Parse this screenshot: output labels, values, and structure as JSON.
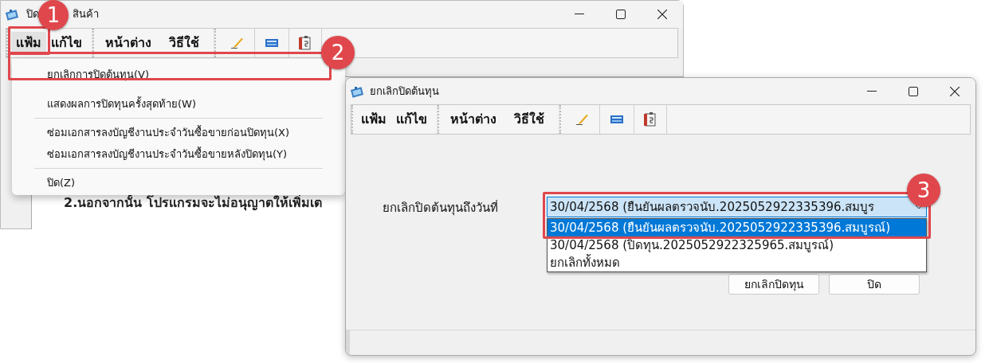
{
  "back_window": {
    "title_parts": [
      "ปิด",
      "สินค้า"
    ],
    "menu": [
      {
        "label": "แฟ้ม",
        "selected": true
      },
      {
        "label": "แก้ไข",
        "selected": false
      },
      {
        "label": "หน้าต่าง",
        "selected": false
      },
      {
        "label": "วิธีใช้",
        "selected": false
      }
    ],
    "dropdown_menu": [
      {
        "kind": "item",
        "label": "ยกเลิกการปิดต้นทุน(V)"
      },
      {
        "kind": "item",
        "label": "แสดงผลการปิดทุนครั้งสุดท้าย(W)"
      },
      {
        "kind": "separator"
      },
      {
        "kind": "item",
        "label": "ซ่อมเอกสารลงบัญชีงานประจำวันซื้อขายก่อนปิดทุน(X)"
      },
      {
        "kind": "item",
        "label": "ซ่อมเอกสารลงบัญชีงานประจำวันซื้อขายหลังปิดทุน(Y)"
      },
      {
        "kind": "separator"
      },
      {
        "kind": "item",
        "label": "ปิด(Z)"
      }
    ],
    "body_text": "2.นอกจากนั้น โปรแกรมจะไม่อนุญาตให้เพิ่มเต"
  },
  "dialog": {
    "title": "ยกเลิกปิดต้นทุน",
    "menu": [
      {
        "label": "แฟ้ม"
      },
      {
        "label": "แก้ไข"
      },
      {
        "label": "หน้าต่าง"
      },
      {
        "label": "วิธีใช้"
      }
    ],
    "field_label": "ยกเลิกปิดต้นทุนถึงวันที่",
    "combo_value": "30/04/2568 (ยืนยันผลตรวจนับ.2025052922335396.สมบูร",
    "options": [
      {
        "label": "30/04/2568 (ยืนยันผลตรวจนับ.2025052922335396.สมบูรณ์)",
        "selected": true
      },
      {
        "label": "30/04/2568 (ปิดทุน.2025052922325965.สมบูรณ์)",
        "selected": false
      },
      {
        "label": "ยกเลิกทั้งหมด",
        "selected": false
      }
    ],
    "buttons": [
      "ยกเลิกปิดทุน",
      "ปิด"
    ]
  },
  "annotations": [
    {
      "number": "1"
    },
    {
      "number": "2"
    },
    {
      "number": "3"
    }
  ]
}
